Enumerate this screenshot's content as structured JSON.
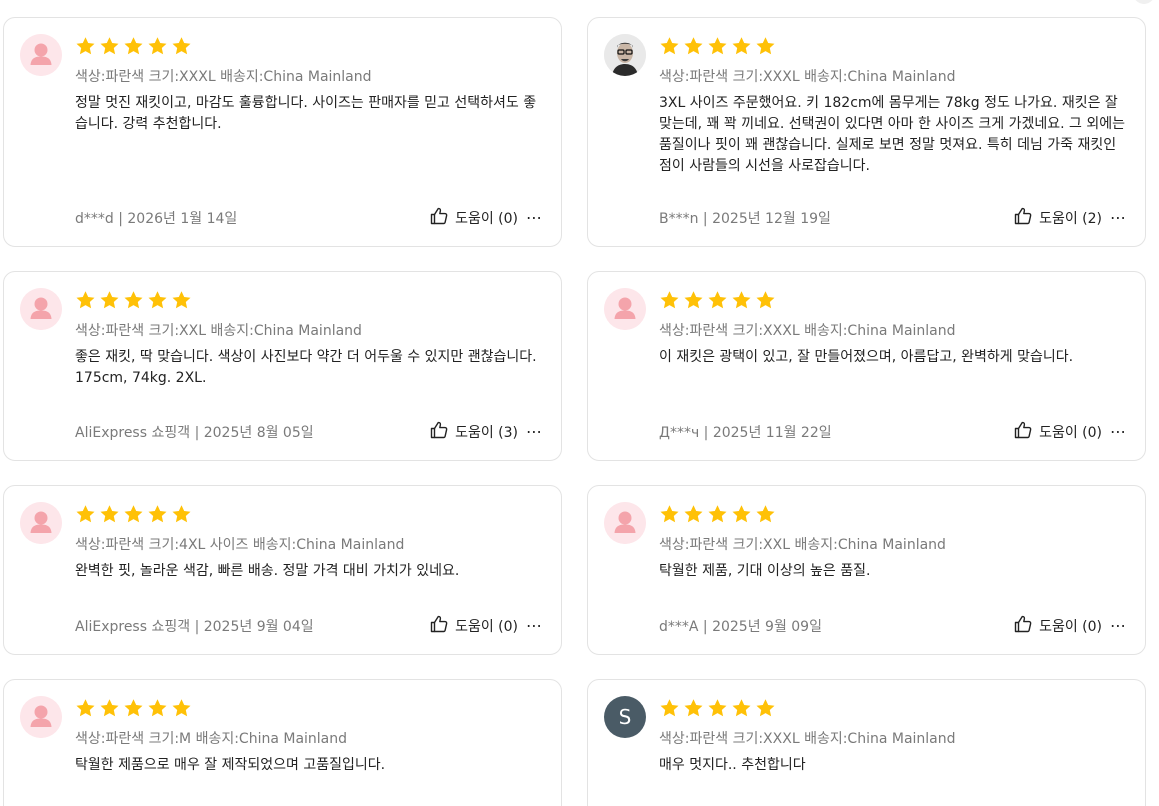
{
  "reviews": [
    {
      "avatar": "default-user-icon",
      "rating": 5,
      "meta": "색상:파란색 크기:XXXL 배송지:China Mainland",
      "text": "정말 멋진 재킷이고, 마감도 훌륭합니다. 사이즈는 판매자를 믿고 선택하셔도 좋습니다. 강력 추천합니다.",
      "author_date": "d***d | 2026년 1월 14일",
      "helpful": "도움이 (0)"
    },
    {
      "avatar": "photo",
      "rating": 5,
      "meta": "색상:파란색 크기:XXXL 배송지:China Mainland",
      "text": "3XL 사이즈 주문했어요. 키 182cm에 몸무게는 78kg 정도 나가요. 재킷은 잘 맞는데, 꽤 꽉 끼네요. 선택권이 있다면 아마 한 사이즈 크게 가겠네요. 그 외에는 품질이나 핏이 꽤 괜찮습니다. 실제로 보면 정말 멋져요. 특히 데님 가죽 재킷인 점이 사람들의 시선을 사로잡습니다.",
      "author_date": "B***n | 2025년 12월 19일",
      "helpful": "도움이 (2)"
    },
    {
      "avatar": "default-user-icon",
      "rating": 5,
      "meta": "색상:파란색 크기:XXL 배송지:China Mainland",
      "text": "좋은 재킷, 딱 맞습니다. 색상이 사진보다 약간 더 어두울 수 있지만 괜찮습니다. 175cm, 74kg. 2XL.",
      "author_date": "AliExpress 쇼핑객 | 2025년 8월 05일",
      "helpful": "도움이 (3)"
    },
    {
      "avatar": "default-user-icon",
      "rating": 5,
      "meta": "색상:파란색 크기:XXXL 배송지:China Mainland",
      "text": "이 재킷은 광택이 있고, 잘 만들어졌으며, 아름답고, 완벽하게 맞습니다.",
      "author_date": "Д***ч | 2025년 11월 22일",
      "helpful": "도움이 (0)"
    },
    {
      "avatar": "default-user-icon",
      "rating": 5,
      "meta": "색상:파란색 크기:4XL 사이즈 배송지:China Mainland",
      "text": "완벽한 핏, 놀라운 색감, 빠른 배송. 정말 가격 대비 가치가 있네요.",
      "author_date": "AliExpress 쇼핑객 | 2025년 9월 04일",
      "helpful": "도움이 (0)"
    },
    {
      "avatar": "default-user-icon",
      "rating": 5,
      "meta": "색상:파란색 크기:XXL 배송지:China Mainland",
      "text": "탁월한 제품, 기대 이상의 높은 품질.",
      "author_date": "d***A | 2025년 9월 09일",
      "helpful": "도움이 (0)"
    },
    {
      "avatar": "default-user-icon",
      "rating": 5,
      "meta": "색상:파란색 크기:M 배송지:China Mainland",
      "text": "탁월한 제품으로 매우 잘 제작되었으며 고품질입니다.",
      "author_date": "",
      "helpful": ""
    },
    {
      "avatar": "letter",
      "avatar_letter": "S",
      "rating": 5,
      "meta": "색상:파란색 크기:XXXL 배송지:China Mainland",
      "text": "매우 멋지다.. 추천합니다",
      "author_date": "",
      "helpful": ""
    }
  ],
  "more_icon": "⋯",
  "colors": {
    "star": "#ffc107",
    "meta_text": "#7a7a7a",
    "border": "#e3e3e3",
    "default_avatar_bg": "#fde6ea",
    "default_avatar_fg": "#f4a4ab",
    "letter_avatar_bg": "#4a5b66"
  }
}
